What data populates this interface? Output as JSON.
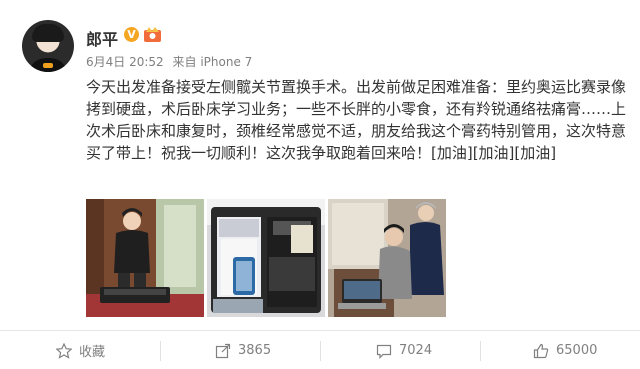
{
  "author": {
    "name": "郎平",
    "verified_badge": "V",
    "verified_color": "#f5a623",
    "avatar_icon": "user-avatar"
  },
  "post": {
    "date": "6月4日 20:52",
    "source": "来自 iPhone 7",
    "text": "今天出发准备接受左侧髋关节置换手术。出发前做足困难准备：里约奥运比赛录像拷到硬盘，术后卧床学习业务；一些不长胖的小零食，还有羚锐通络祛痛膏……上次术后卧床和康复时，颈椎经常感觉不适，朋友给我这个膏药特别管用，这次特意买了带上！祝我一切顺利！这次我争取跑着回来哈！[加油][加油][加油]"
  },
  "photos": [
    {
      "icon": "photo-person-with-suitcase"
    },
    {
      "icon": "photo-packed-suitcase"
    },
    {
      "icon": "photo-laptop-review"
    }
  ],
  "actions": {
    "favorite": {
      "label": "收藏",
      "icon": "star-icon"
    },
    "repost": {
      "count": "3865",
      "icon": "repost-icon"
    },
    "comment": {
      "count": "7024",
      "icon": "comment-icon"
    },
    "like": {
      "count": "65000",
      "icon": "thumbs-up-icon"
    }
  }
}
